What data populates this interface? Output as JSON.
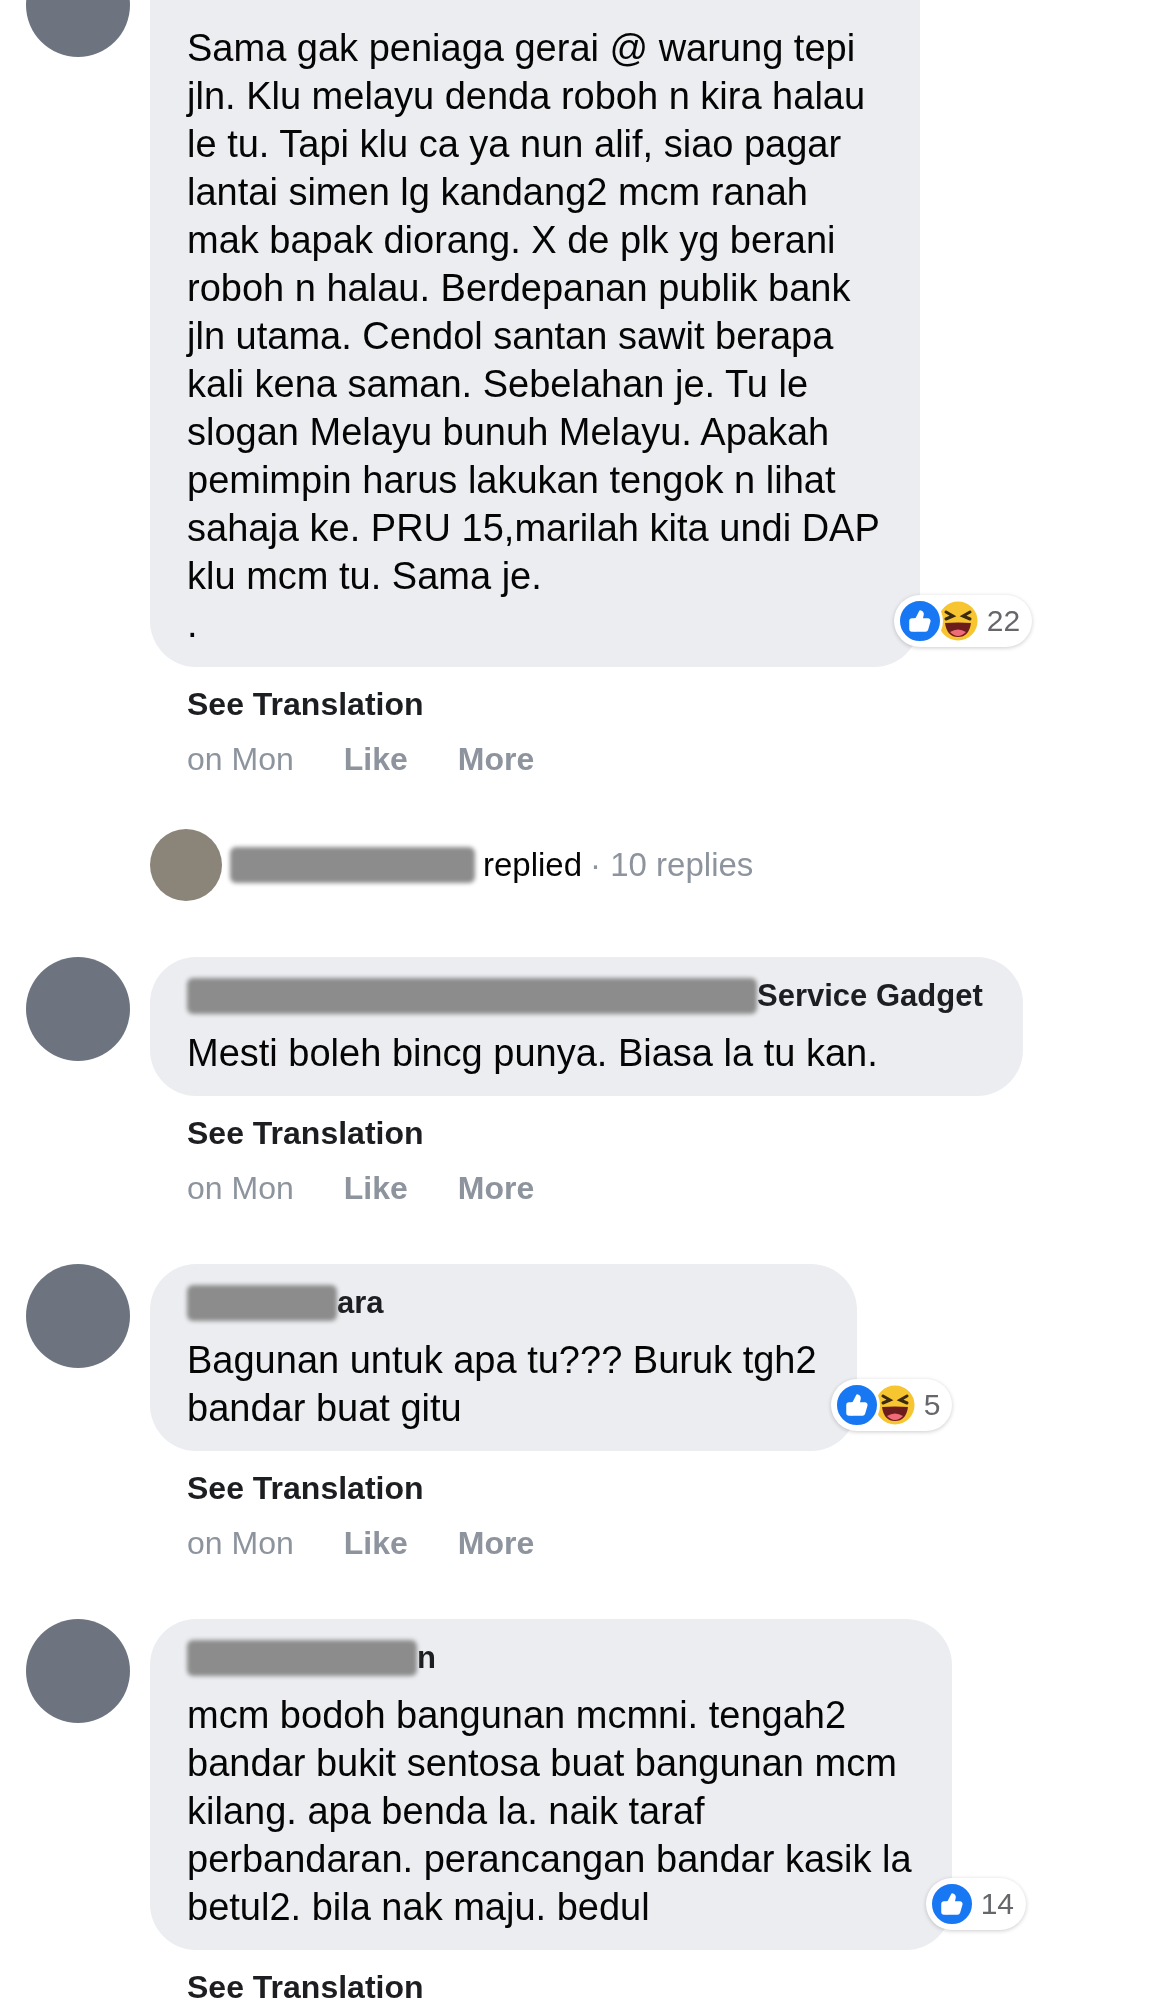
{
  "comments": [
    {
      "text": "Sama gak peniaga gerai @ warung tepi\njln. Klu melayu denda roboh n kira halau\nle tu. Tapi klu ca ya nun alif, siao pagar\nlantai simen lg kandang2 mcm ranah\nmak bapak diorang. X de plk yg berani\nroboh n halau. Berdepanan publik bank\njln utama. Cendol santan sawit berapa\nkali kena saman. Sebelahan je. Tu le\nslogan Melayu bunuh Melayu. Apakah\npemimpin harus lakukan tengok n lihat\nsahaja ke. PRU 15,marilah kita undi DAP\nklu mcm tu. Sama je.\n.",
      "reactions": {
        "icons": [
          {
            "kind": "like"
          },
          {
            "kind": "haha"
          }
        ],
        "count": "22"
      },
      "see_translation": "See Translation",
      "time": "on Mon",
      "actions": [
        "Like",
        "More"
      ],
      "reply_summary": {
        "text": "replied",
        "count": "· 10 replies"
      }
    },
    {
      "name": "Service Gadget",
      "text": "Mesti boleh bincg punya. Biasa la tu kan.",
      "see_translation": "See Translation",
      "time": "on Mon",
      "actions": [
        "Like",
        "More"
      ]
    },
    {
      "name": "ara",
      "text": "Bagunan untuk apa tu??? Buruk tgh2\nbandar buat gitu",
      "reactions": {
        "icons": [
          {
            "kind": "like"
          },
          {
            "kind": "haha"
          }
        ],
        "count": "5"
      },
      "see_translation": "See Translation",
      "time": "on Mon",
      "actions": [
        "Like",
        "More"
      ]
    },
    {
      "name": "n",
      "text": "mcm bodoh bangunan mcmni. tengah2\nbandar bukit sentosa buat bangunan mcm\nkilang. apa benda la. naik taraf\nperbandaran. perancangan bandar kasik la\nbetul2. bila nak maju. bedul",
      "reactions": {
        "icons": [
          {
            "kind": "like"
          }
        ],
        "count": "14"
      },
      "see_translation": "See Translation"
    }
  ]
}
